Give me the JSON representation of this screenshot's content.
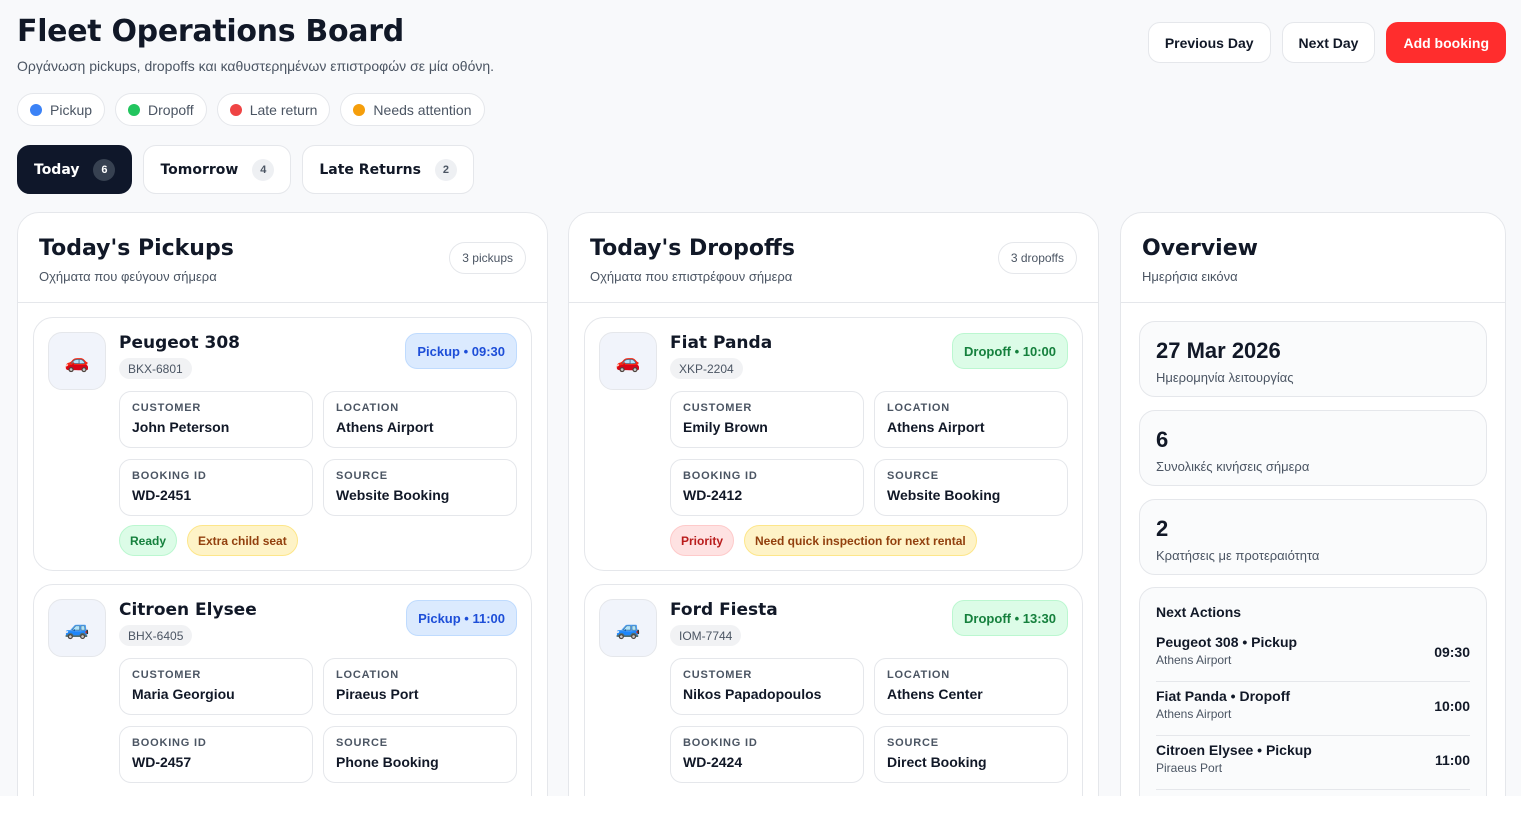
{
  "header": {
    "title": "Fleet Operations Board",
    "subtitle": "Οργάνωση pickups, dropoffs και καθυστερημένων επιστροφών σε μία οθόνη.",
    "actions": {
      "prev": "Previous Day",
      "next": "Next Day",
      "add": "Add booking"
    }
  },
  "legend": [
    {
      "label": "Pickup",
      "color": "#3b82f6"
    },
    {
      "label": "Dropoff",
      "color": "#22c55e"
    },
    {
      "label": "Late return",
      "color": "#ef4444"
    },
    {
      "label": "Needs attention",
      "color": "#f59e0b"
    }
  ],
  "tabs": [
    {
      "label": "Today",
      "count": "6"
    },
    {
      "label": "Tomorrow",
      "count": "4"
    },
    {
      "label": "Late Returns",
      "count": "2"
    }
  ],
  "pickups": {
    "title": "Today's Pickups",
    "subtitle": "Οχήματα που φεύγουν σήμερα",
    "count": "3 pickups",
    "cards": [
      {
        "icon": "red-car-icon",
        "emoji": "🚗",
        "car": "Peugeot 308",
        "plate": "BKX-6801",
        "badge": "Pickup • 09:30",
        "customer_label": "CUSTOMER",
        "customer": "John Peterson",
        "location_label": "LOCATION",
        "location": "Athens Airport",
        "booking_label": "BOOKING ID",
        "booking": "WD-2451",
        "source_label": "SOURCE",
        "source": "Website Booking",
        "tags": [
          "Ready",
          "Extra child seat"
        ]
      },
      {
        "icon": "blue-car-icon",
        "emoji": "🚙",
        "car": "Citroen Elysee",
        "plate": "BHX-6405",
        "badge": "Pickup • 11:00",
        "customer_label": "CUSTOMER",
        "customer": "Maria Georgiou",
        "location_label": "LOCATION",
        "location": "Piraeus Port",
        "booking_label": "BOOKING ID",
        "booking": "WD-2457",
        "source_label": "SOURCE",
        "source": "Phone Booking"
      }
    ]
  },
  "dropoffs": {
    "title": "Today's Dropoffs",
    "subtitle": "Οχήματα που επιστρέφουν σήμερα",
    "count": "3 dropoffs",
    "cards": [
      {
        "icon": "red-car-icon",
        "emoji": "🚗",
        "car": "Fiat Panda",
        "plate": "XKP-2204",
        "badge": "Dropoff • 10:00",
        "customer_label": "CUSTOMER",
        "customer": "Emily Brown",
        "location_label": "LOCATION",
        "location": "Athens Airport",
        "booking_label": "BOOKING ID",
        "booking": "WD-2412",
        "source_label": "SOURCE",
        "source": "Website Booking",
        "tags": [
          "Priority",
          "Need quick inspection for next rental"
        ]
      },
      {
        "icon": "blue-car-icon",
        "emoji": "🚙",
        "car": "Ford Fiesta",
        "plate": "IOM-7744",
        "badge": "Dropoff • 13:30",
        "customer_label": "CUSTOMER",
        "customer": "Nikos Papadopoulos",
        "location_label": "LOCATION",
        "location": "Athens Center",
        "booking_label": "BOOKING ID",
        "booking": "WD-2424",
        "source_label": "SOURCE",
        "source": "Direct Booking"
      }
    ]
  },
  "overview": {
    "title": "Overview",
    "subtitle": "Ημερήσια εικόνα",
    "date": {
      "value": "27 Mar 2026",
      "label": "Ημερομηνία λειτουργίας"
    },
    "moves": {
      "value": "6",
      "label": "Συνολικές κινήσεις σήμερα"
    },
    "priority": {
      "value": "2",
      "label": "Κρατήσεις με προτεραιότητα"
    },
    "next_actions": {
      "title": "Next Actions",
      "items": [
        {
          "main": "Peugeot 308 • Pickup",
          "sub": "Athens Airport",
          "time": "09:30"
        },
        {
          "main": "Fiat Panda • Dropoff",
          "sub": "Athens Airport",
          "time": "10:00"
        },
        {
          "main": "Citroen Elysee • Pickup",
          "sub": "Piraeus Port",
          "time": "11:00"
        }
      ]
    }
  }
}
